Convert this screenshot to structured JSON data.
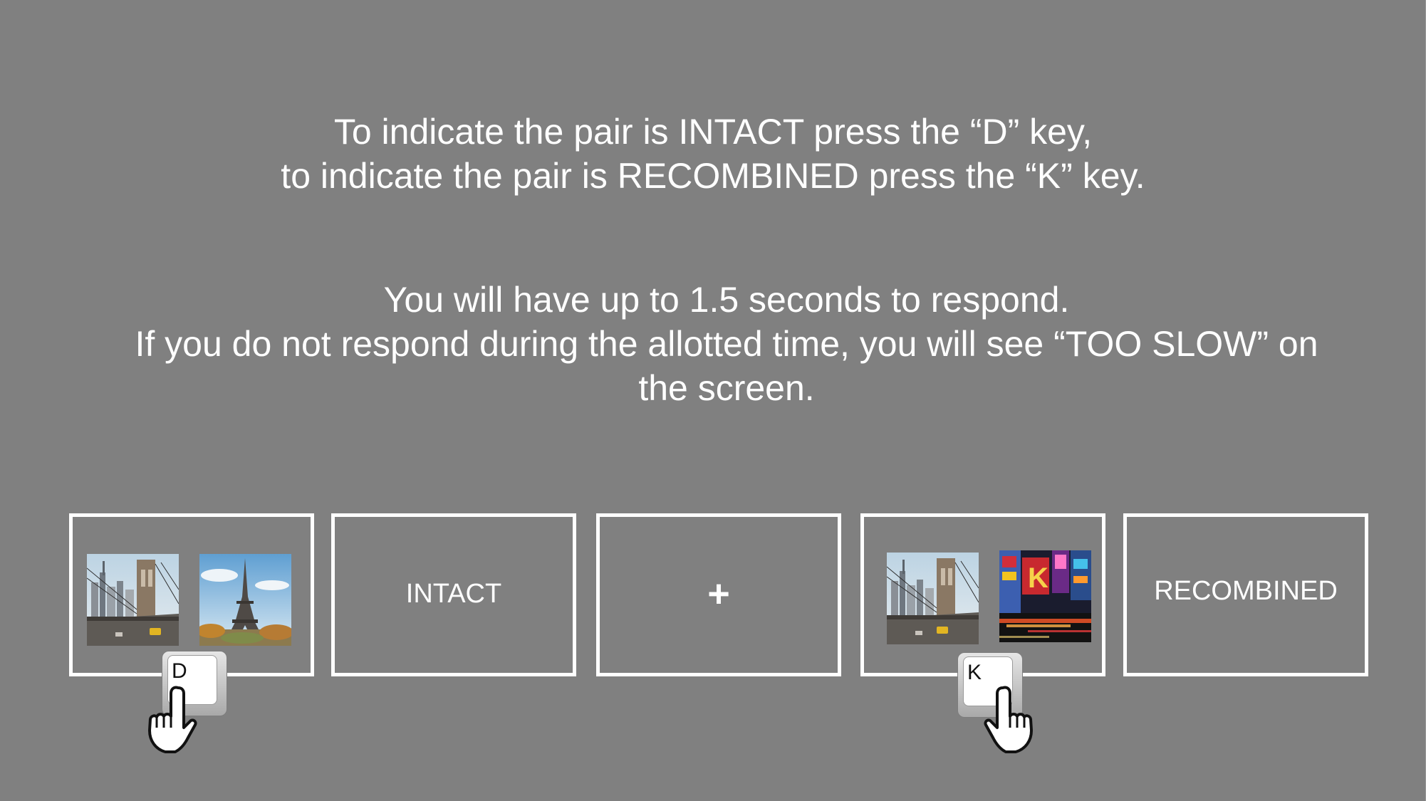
{
  "instructions": {
    "line1": "To indicate the pair is INTACT press the “D” key,",
    "line2": "to indicate the pair is RECOMBINED press the “K” key.",
    "line3": "You will have up to 1.5 seconds to respond.",
    "line4": "If you do not respond during the allotted time, you will see “TOO SLOW” on",
    "line5": "the screen."
  },
  "frames": {
    "intact_pair": {
      "left_image": "brooklyn-bridge-photo",
      "right_image": "eiffel-tower-photo"
    },
    "intact_label": "INTACT",
    "fixation": "+",
    "recombined_pair": {
      "left_image": "brooklyn-bridge-photo",
      "right_image": "times-square-photo"
    },
    "recombined_label": "RECOMBINED"
  },
  "keys": {
    "intact_key": "D",
    "recombined_key": "K"
  },
  "icons": {
    "pointing_hand": "pointing-hand-icon",
    "keycap": "keyboard-key-icon"
  },
  "colors": {
    "background": "#808080",
    "text": "#ffffff",
    "frame_border": "#ffffff"
  }
}
